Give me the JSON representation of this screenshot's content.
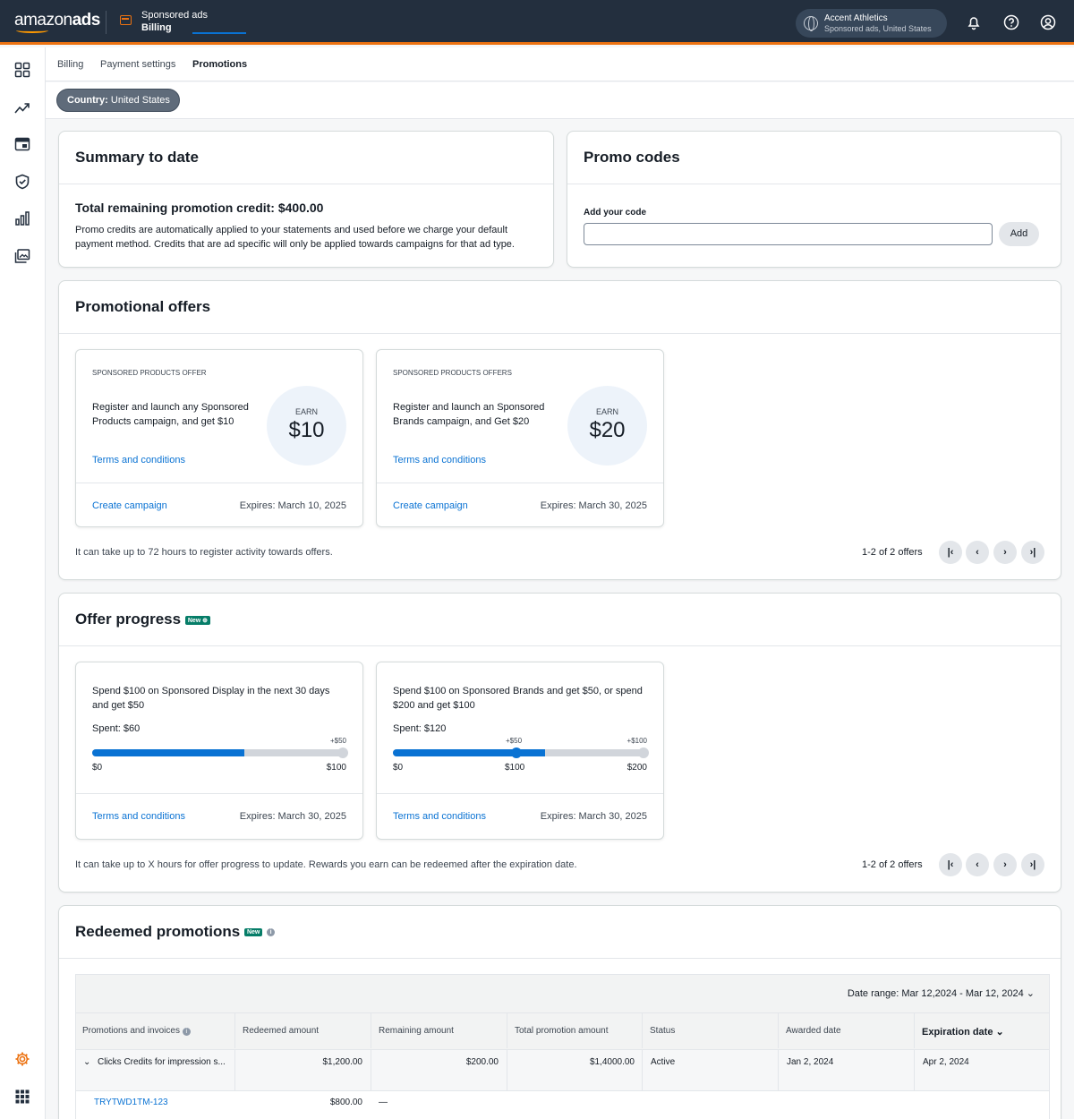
{
  "header": {
    "logo_a": "amazon",
    "logo_b": "ads",
    "context_top": "Sponsored ads",
    "context_bottom": "Billing",
    "account_name": "Accent Athletics",
    "account_sub": "Sponsored ads, United States",
    "icons": [
      "bell-icon",
      "help-icon",
      "user-icon"
    ]
  },
  "sidebar": {
    "icons": [
      "dashboard-icon",
      "trend-icon",
      "ads-icon",
      "brand-shield-icon",
      "reports-icon",
      "media-icon",
      "settings-icon",
      "apps-grid-icon"
    ]
  },
  "tabs": [
    {
      "label": "Billing"
    },
    {
      "label": "Payment settings"
    },
    {
      "label": "Promotions",
      "active": true
    }
  ],
  "filter": {
    "key": "Country:",
    "value": "United States"
  },
  "summary": {
    "title": "Summary to date",
    "total": "Total remaining promotion credit: $400.00",
    "line1": "Promo credits are automatically applied to your statements and used before we charge your default",
    "line2": "payment method. Credits that are ad specific will only be applied towards campaigns for that ad type."
  },
  "promo_codes": {
    "title": "Promo codes",
    "label": "Add your code",
    "value": "",
    "add_label": "Add"
  },
  "offers": {
    "title": "Promotional offers",
    "items": [
      {
        "eyebrow": "SPONSORED PRODUCTS OFFER",
        "line1": "Register and launch any Sponsored",
        "line2": "Products campaign, and get $10",
        "terms": "Terms and conditions",
        "earn_label": "EARN",
        "earn_value": "$10",
        "cta": "Create campaign",
        "expires": "Expires: March 10, 2025"
      },
      {
        "eyebrow": "SPONSORED PRODUCTS OFFERS",
        "line1": "Register and launch an Sponsored",
        "line2": "Brands campaign, and Get $20",
        "terms": "Terms and conditions",
        "earn_label": "EARN",
        "earn_value": "$20",
        "cta": "Create campaign",
        "expires": "Expires: March 30, 2025"
      }
    ],
    "footnote": "It can take up to 72 hours to register activity towards offers.",
    "page_info": "1-2 of 2 offers"
  },
  "progress": {
    "title": "Offer progress",
    "badge": "New",
    "items": [
      {
        "line1": "Spend $100 on Sponsored Display in the next 30 days",
        "line2": "and get $50",
        "spent": "Spent: $60",
        "progress": 0.6,
        "reward_end": "+$50",
        "min": "$0",
        "max": "$100",
        "terms": "Terms and conditions",
        "expires": "Expires: March 30, 2025"
      },
      {
        "line1": "Spend $100 on Sponsored Brands and get $50, or spend",
        "line2": "$200 and get $100",
        "spent": "Spent: $120",
        "progress": 0.6,
        "reward_mid": "+$50",
        "reward_end": "+$100",
        "min": "$0",
        "mid": "$100",
        "max": "$200",
        "terms": "Terms and conditions",
        "expires": "Expires: March 30, 2025"
      }
    ],
    "footnote": "It can take up to X hours for offer progress to update. Rewards you earn can be redeemed after the expiration date.",
    "page_info": "1-2 of 2 offers"
  },
  "redeemed": {
    "title": "Redeemed promotions",
    "badge": "New",
    "date_range": "Date range: Mar 12,2024 - Mar 12, 2024",
    "columns": [
      "Promotions and invoices",
      "Redeemed amount",
      "Remaining amount",
      "Total promotion amount",
      "Status",
      "Awarded date",
      "Expiration date"
    ],
    "rows": [
      {
        "name": "Clicks Credits for impression s...",
        "redeemed": "$1,200.00",
        "remaining": "$200.00",
        "total": "$1,4000.00",
        "status": "Active",
        "awarded": "Jan 2, 2024",
        "expiration": "Apr 2, 2024"
      },
      {
        "name": "TRYTWD1TM-123",
        "redeemed": "$800.00",
        "remaining": "—"
      }
    ]
  },
  "colors": {
    "accent": "#0972d3",
    "brand_orange": "#ec7211",
    "nav": "#232f3e"
  }
}
